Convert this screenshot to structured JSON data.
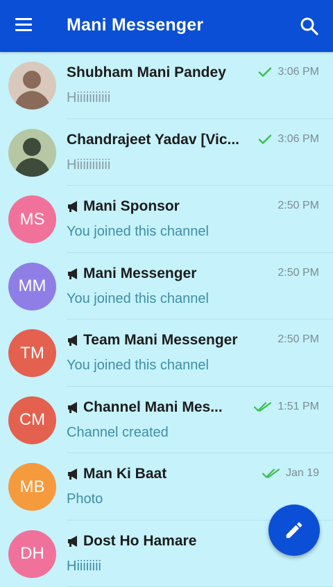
{
  "header": {
    "title": "Mani Messenger",
    "menu_icon": "hamburger-menu-icon",
    "search_icon": "search-icon"
  },
  "chats": [
    {
      "name": "Shubham Mani Pandey",
      "preview": "Hiiiiiiiiiii",
      "time": "3:06 PM",
      "status": "sent-single-check",
      "avatar_type": "photo",
      "is_channel": false
    },
    {
      "name": "Chandrajeet Yadav [Vic...",
      "preview": "Hiiiiiiiiiii",
      "time": "3:06 PM",
      "status": "sent-single-check",
      "avatar_type": "photo",
      "is_channel": false
    },
    {
      "name": "Mani Sponsor",
      "preview": "You joined this channel",
      "time": "2:50 PM",
      "status": "none",
      "avatar_initials": "MS",
      "avatar_color": "#f0729a",
      "is_channel": true
    },
    {
      "name": "Mani Messenger",
      "preview": "You joined this channel",
      "time": "2:50 PM",
      "status": "none",
      "avatar_initials": "MM",
      "avatar_color": "#8f7ee6",
      "is_channel": true
    },
    {
      "name": "Team Mani Messenger",
      "preview": "You joined this channel",
      "time": "2:50 PM",
      "status": "none",
      "avatar_initials": "TM",
      "avatar_color": "#e4604f",
      "is_channel": true
    },
    {
      "name": "Channel Mani Mes...",
      "preview": "Channel created",
      "time": "1:51 PM",
      "status": "read-double-check",
      "avatar_initials": "CM",
      "avatar_color": "#e4604f",
      "is_channel": true
    },
    {
      "name": "Man Ki Baat",
      "preview": "Photo",
      "time": "Jan 19",
      "status": "read-double-check",
      "avatar_initials": "MB",
      "avatar_color": "#f59a3d",
      "is_channel": true
    },
    {
      "name": "Dost Ho Hamare",
      "preview": "Hiiiiiiii",
      "time": "",
      "status": "read-double-check",
      "avatar_initials": "DH",
      "avatar_color": "#f0729a",
      "is_channel": true
    }
  ],
  "fab": {
    "icon": "pencil-icon"
  },
  "colors": {
    "appbar": "#0a4fd6",
    "background": "#c6f2fb",
    "check": "#3bbf4a",
    "preview_text": "#3f8fa6"
  }
}
